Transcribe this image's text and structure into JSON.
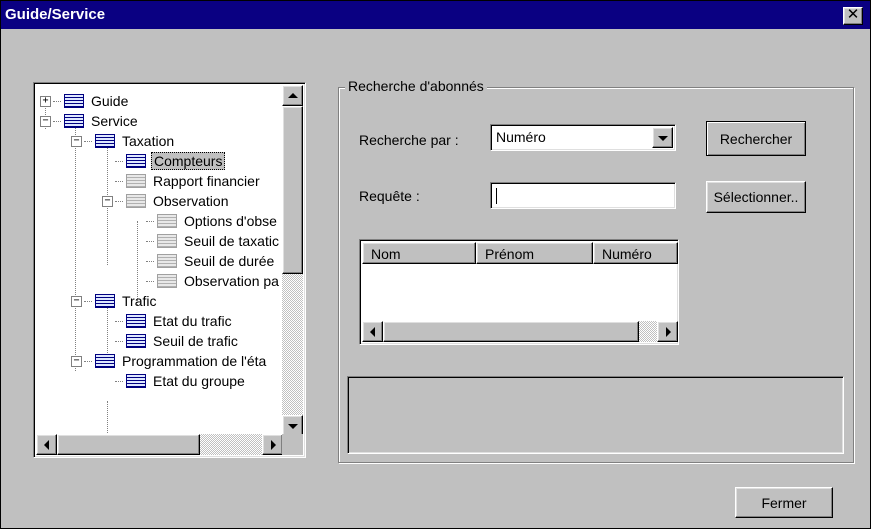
{
  "window": {
    "title": "Guide/Service",
    "close_glyph": "✕"
  },
  "tree": {
    "items": [
      {
        "label": "Guide",
        "expander": "+",
        "icon": "blue"
      },
      {
        "label": "Service",
        "expander": "−",
        "icon": "blue"
      },
      {
        "label": "Taxation",
        "expander": "−",
        "icon": "blue"
      },
      {
        "label": "Compteurs",
        "expander": "",
        "icon": "blue",
        "selected": true
      },
      {
        "label": "Rapport financier",
        "expander": "",
        "icon": "grey"
      },
      {
        "label": "Observation",
        "expander": "−",
        "icon": "grey"
      },
      {
        "label": "Options d'obse",
        "expander": "",
        "icon": "grey"
      },
      {
        "label": "Seuil de taxatic",
        "expander": "",
        "icon": "grey"
      },
      {
        "label": "Seuil de durée",
        "expander": "",
        "icon": "grey"
      },
      {
        "label": "Observation pa",
        "expander": "",
        "icon": "grey"
      },
      {
        "label": "Trafic",
        "expander": "−",
        "icon": "blue"
      },
      {
        "label": "Etat du trafic",
        "expander": "",
        "icon": "blue"
      },
      {
        "label": "Seuil de trafic",
        "expander": "",
        "icon": "blue"
      },
      {
        "label": "Programmation de l'éta",
        "expander": "−",
        "icon": "blue"
      },
      {
        "label": "Etat du groupe",
        "expander": "",
        "icon": "blue"
      }
    ]
  },
  "search": {
    "group_label": "Recherche d'abonnés",
    "by_label": "Recherche par :",
    "by_value": "Numéro",
    "query_label": "Requête :",
    "query_value": "",
    "search_button": "Rechercher",
    "select_button": "Sélectionner..",
    "columns": [
      "Nom",
      "Prénom",
      "Numéro"
    ]
  },
  "footer": {
    "close_button": "Fermer"
  },
  "colors": {
    "titlebar": "#0a0082",
    "face": "#c0c0c0"
  }
}
